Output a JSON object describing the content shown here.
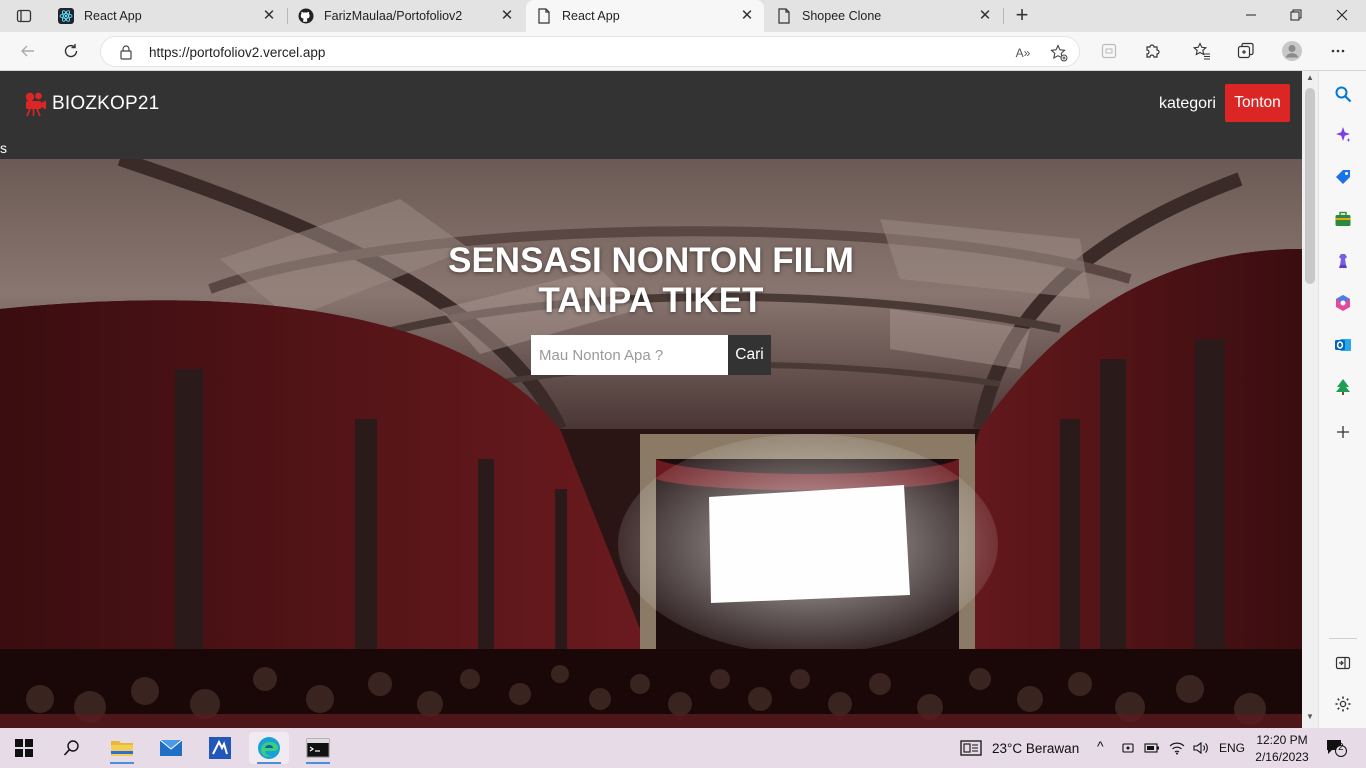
{
  "browser": {
    "tabs": [
      {
        "title": "React App",
        "favicon": "react-icon",
        "active": false
      },
      {
        "title": "FarizMaulaa/Portofoliov2",
        "favicon": "github-icon",
        "active": false
      },
      {
        "title": "React App",
        "favicon": "page-icon",
        "active": true
      },
      {
        "title": "Shopee Clone",
        "favicon": "page-icon",
        "active": false
      }
    ],
    "url": "https://portofoliov2.vercel.app",
    "read_aloud_label": "A»"
  },
  "page": {
    "brand": "BIOZKOP21",
    "nav_link": "kategori",
    "nav_button": "Tonton",
    "stray_text": "s",
    "hero_title_line1": "SENSASI NONTON FILM",
    "hero_title_line2": "TANPA TIKET",
    "search_placeholder": "Mau Nonton Apa ?",
    "search_button": "Cari"
  },
  "taskbar": {
    "weather": "23°C  Berawan",
    "language": "ENG",
    "time": "12:20 PM",
    "date": "2/16/2023",
    "notification_count": "2"
  },
  "colors": {
    "accent_red": "#dc2626",
    "navbar_bg": "#333333",
    "edge_blue": "#0078d4"
  }
}
